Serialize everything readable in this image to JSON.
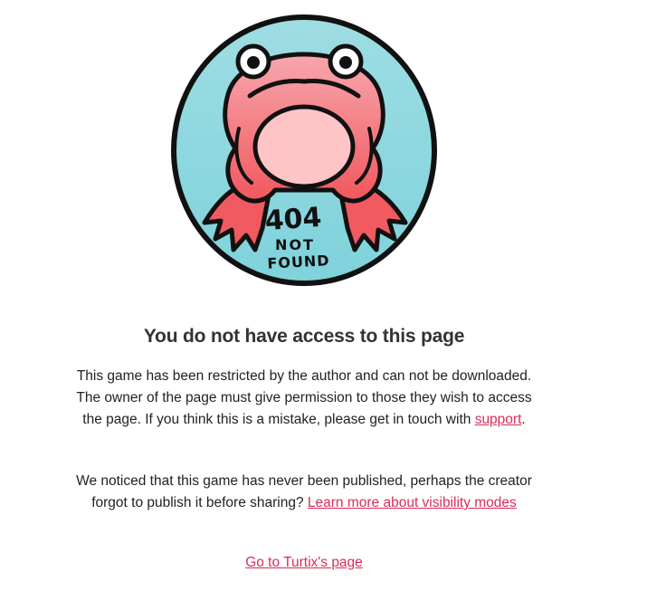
{
  "illustration": {
    "icon": "frog-404-icon",
    "code_text": "404",
    "line1": "NOT",
    "line2": "FOUND",
    "colors": {
      "badge_fill": "#8fd8e0",
      "frog_body": "#f2838a",
      "frog_belly": "#ffc4c6",
      "outline": "#111111"
    }
  },
  "title": "You do not have access to this page",
  "paragraph1": {
    "text": "This game has been restricted by the author and can not be downloaded. The owner of the page must give permission to those they wish to access the page. If you think this is a mistake, please get in touch with ",
    "link_label": "support",
    "suffix": "."
  },
  "paragraph2": {
    "text": "We noticed that this game has never been published, perhaps the creator forgot to publish it before sharing? ",
    "link_label": "Learn more about visibility modes"
  },
  "goto_link_label": "Go to Turtix's page",
  "colors": {
    "link": "#da2c5a",
    "text": "#222222",
    "title": "#333333"
  }
}
